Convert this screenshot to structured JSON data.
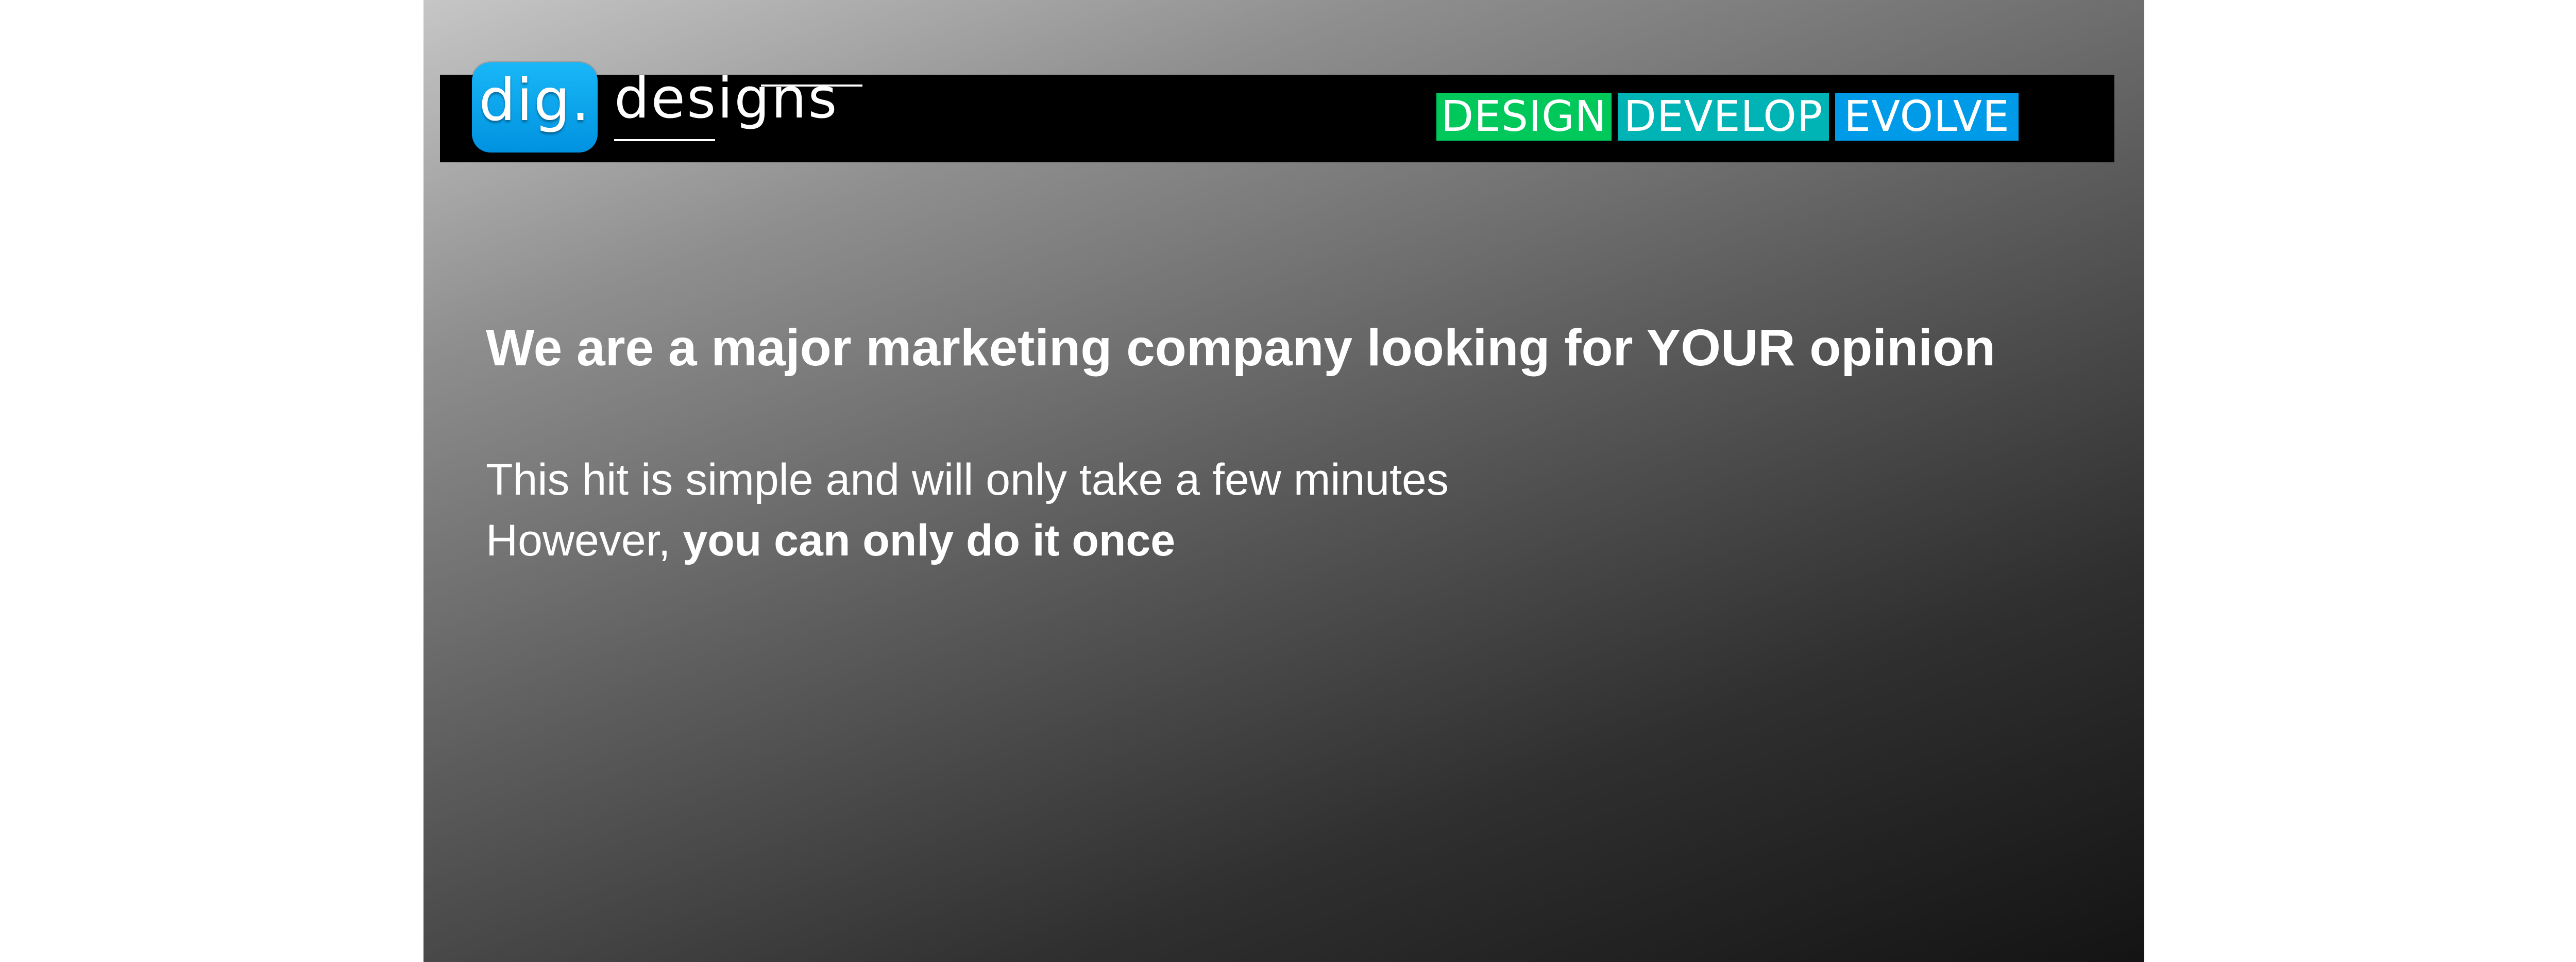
{
  "brand": {
    "badge_text": "dig.",
    "wordmark": "designs",
    "badge_color": "#0aa6ee"
  },
  "taglines": {
    "design": {
      "label": "DESIGN",
      "color": "#00c85a"
    },
    "develop": {
      "label": "DEVELOP",
      "color": "#00b4b6"
    },
    "evolve": {
      "label": "EVOLVE",
      "color": "#009be8"
    }
  },
  "content": {
    "headline": "We are a major marketing company looking for YOUR opinion",
    "line1": "This hit is simple and will only take a few minutes",
    "line2_prefix": "However, ",
    "line2_bold": "you can only do it once"
  }
}
